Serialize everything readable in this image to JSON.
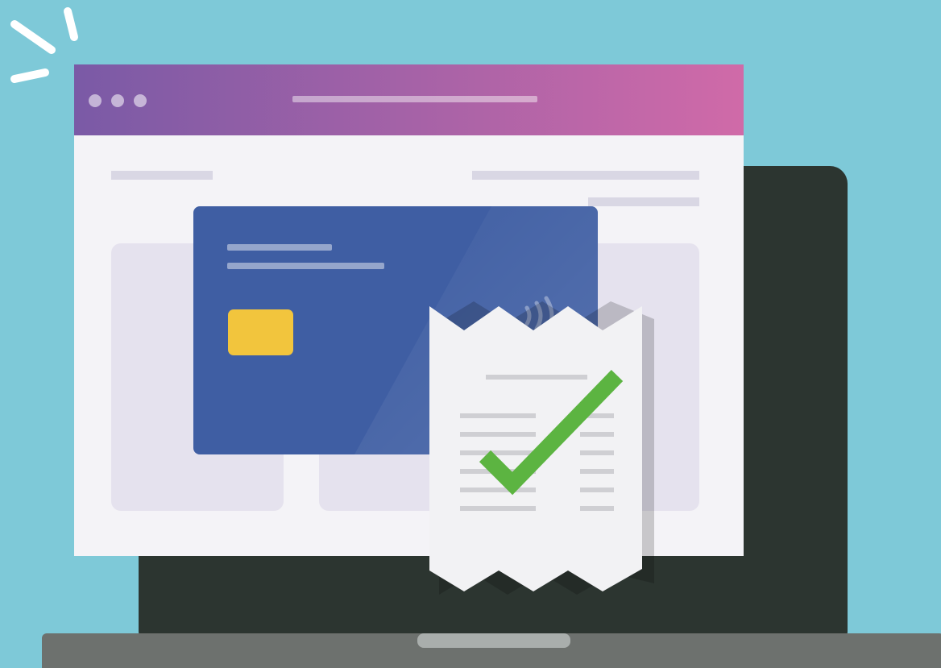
{
  "colors": {
    "background": "#7ec9d8",
    "laptop_screen": "#2c3530",
    "laptop_base": "#6d716e",
    "laptop_notch": "#a9aeac",
    "titlebar_start": "#7a5aa6",
    "titlebar_end": "#d06aa8",
    "window_body": "#f4f3f7",
    "placeholder_line": "#d9d7e4",
    "placeholder_card": "#e5e2ee",
    "credit_card": "#3f5ea3",
    "card_chip": "#f2c53d",
    "receipt": "#f2f2f4",
    "receipt_line": "#cfcfd3",
    "checkmark": "#5cb441",
    "spark": "#ffffff"
  },
  "icons": {
    "window_controls": "three-dots-icon",
    "contactless": "contactless-icon",
    "check": "checkmark-icon",
    "sparkle": "sparkle-icon"
  }
}
